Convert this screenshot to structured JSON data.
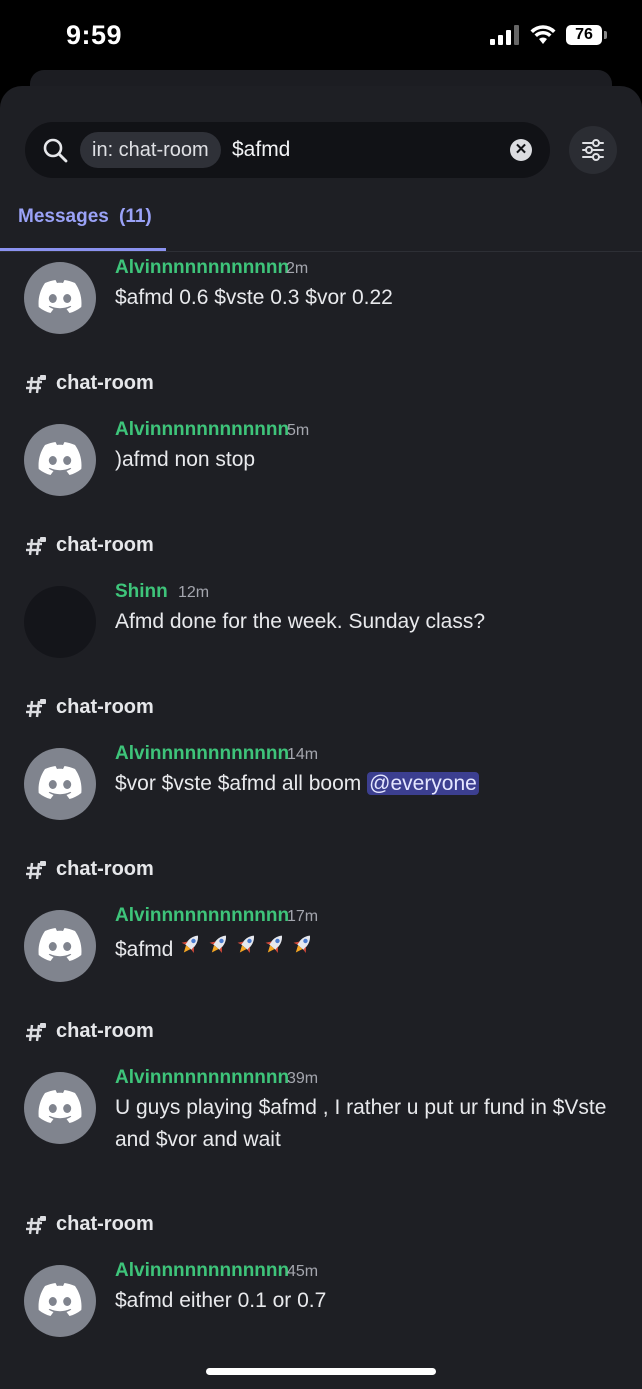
{
  "status": {
    "time": "9:59",
    "battery": "76"
  },
  "search": {
    "filter_chip": "in: chat-room",
    "query": "$afmd"
  },
  "tabs": {
    "messages_label": "Messages",
    "messages_count": "(11)"
  },
  "results": [
    {
      "channel": null,
      "author": "Alvinnnnnnnnnnnn",
      "time": "2m",
      "avatar": "discord-logo",
      "content": "$afmd 0.6  $vste 0.3 $vor 0.22"
    },
    {
      "channel": "chat-room",
      "author": "Alvinnnnnnnnnnnn",
      "time": "5m",
      "avatar": "discord-logo",
      "content": ")afmd non stop"
    },
    {
      "channel": "chat-room",
      "author": "Shinn",
      "time": "12m",
      "avatar": "dark",
      "content": "Afmd done for the week. Sunday class?"
    },
    {
      "channel": "chat-room",
      "author": "Alvinnnnnnnnnnnn",
      "time": "14m",
      "avatar": "discord-logo",
      "content": "$vor $vste $afmd all boom",
      "mention": "@everyone"
    },
    {
      "channel": "chat-room",
      "author": "Alvinnnnnnnnnnnn",
      "time": "17m",
      "avatar": "discord-logo",
      "content": "$afmd",
      "rockets": 5
    },
    {
      "channel": "chat-room",
      "author": "Alvinnnnnnnnnnnn",
      "time": "39m",
      "avatar": "discord-logo",
      "content": "U guys playing $afmd  , I rather u put ur fund in $Vste and $vor and wait"
    },
    {
      "channel": "chat-room",
      "author": "Alvinnnnnnnnnnnn",
      "time": "45m",
      "avatar": "discord-logo",
      "content": "$afmd either 0.1 or 0.7"
    }
  ],
  "colors": {
    "accent": "#8b92f0",
    "author": "#3ec47a",
    "background": "#1e1f24"
  }
}
